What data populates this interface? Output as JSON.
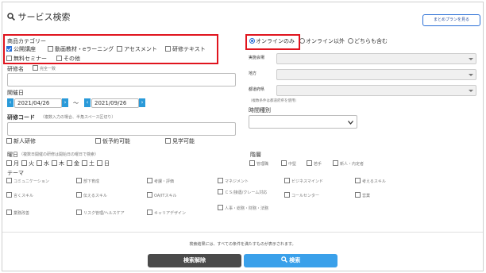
{
  "header": {
    "title": "サービス検索",
    "summary_plan_label": "まとめプランを見る"
  },
  "category": {
    "label": "商品カテゴリー",
    "items": [
      {
        "label": "公開講座",
        "checked": true
      },
      {
        "label": "動画教材・eラーニング",
        "checked": false
      },
      {
        "label": "アセスメント",
        "checked": false
      },
      {
        "label": "研修テキスト",
        "checked": false
      },
      {
        "label": "無料セミナー",
        "checked": false
      },
      {
        "label": "その他",
        "checked": false
      }
    ]
  },
  "training_name": {
    "label": "研修名",
    "exact_match_label": "完全一致",
    "value": ""
  },
  "dates": {
    "label": "開催日",
    "from": "2021/04/26",
    "separator": "～",
    "to": "2021/09/26"
  },
  "training_code": {
    "label": "研修コード",
    "hint": "（複数入力の場合、半角スペース区切り）",
    "value": ""
  },
  "options": {
    "new_training": "新人研修",
    "reservable": "仮予約可能",
    "viewable": "見学可能"
  },
  "weekday": {
    "label": "曜日",
    "hint": "（複数日開催の研修は開始日の曜日で検索）",
    "days": [
      "月",
      "火",
      "水",
      "木",
      "金",
      "土",
      "日"
    ]
  },
  "level": {
    "label": "階層",
    "items": [
      "管理職",
      "中堅",
      "若手",
      "新人・内定者"
    ]
  },
  "theme": {
    "label": "テーマ",
    "col1": [
      "コミュニケーション",
      "言くスキル",
      "業務改善"
    ],
    "col2": [
      "部下育成",
      "伝えるスキル",
      "リスク管理/ヘルスケア"
    ],
    "col3": [
      "考課・評価",
      "OA/ITスキル",
      "キャリアデザイン"
    ],
    "col4": [
      "マネジメント",
      "ＣＳ/接遇/クレーム対応",
      "人事・総務・財務・法務"
    ],
    "col5": [
      "ビジネスマインド",
      "コールセンター"
    ],
    "col6": [
      "考えるスキル",
      "営業"
    ]
  },
  "scope": {
    "online_only": "オンラインのみ",
    "non_online": "オンライン以外",
    "both": "どちらも含む",
    "selected": "online_only"
  },
  "venue": {
    "label": "実施会場",
    "region_label": "地方",
    "prefecture_label": "都道府県",
    "prefecture_hint": "（複数条件は都道府県を使用）"
  },
  "time_type": {
    "label": "時間種別",
    "value": ""
  },
  "footer": {
    "note": "検索結果には、すべての条件を満たすものが表示されます。",
    "clear_label": "検索解除",
    "search_label": "検索"
  },
  "colors": {
    "accent": "#2a6fd6",
    "search_button": "#3aa0ea",
    "clear_button": "#4a4a4a",
    "highlight": "#e0141e"
  }
}
